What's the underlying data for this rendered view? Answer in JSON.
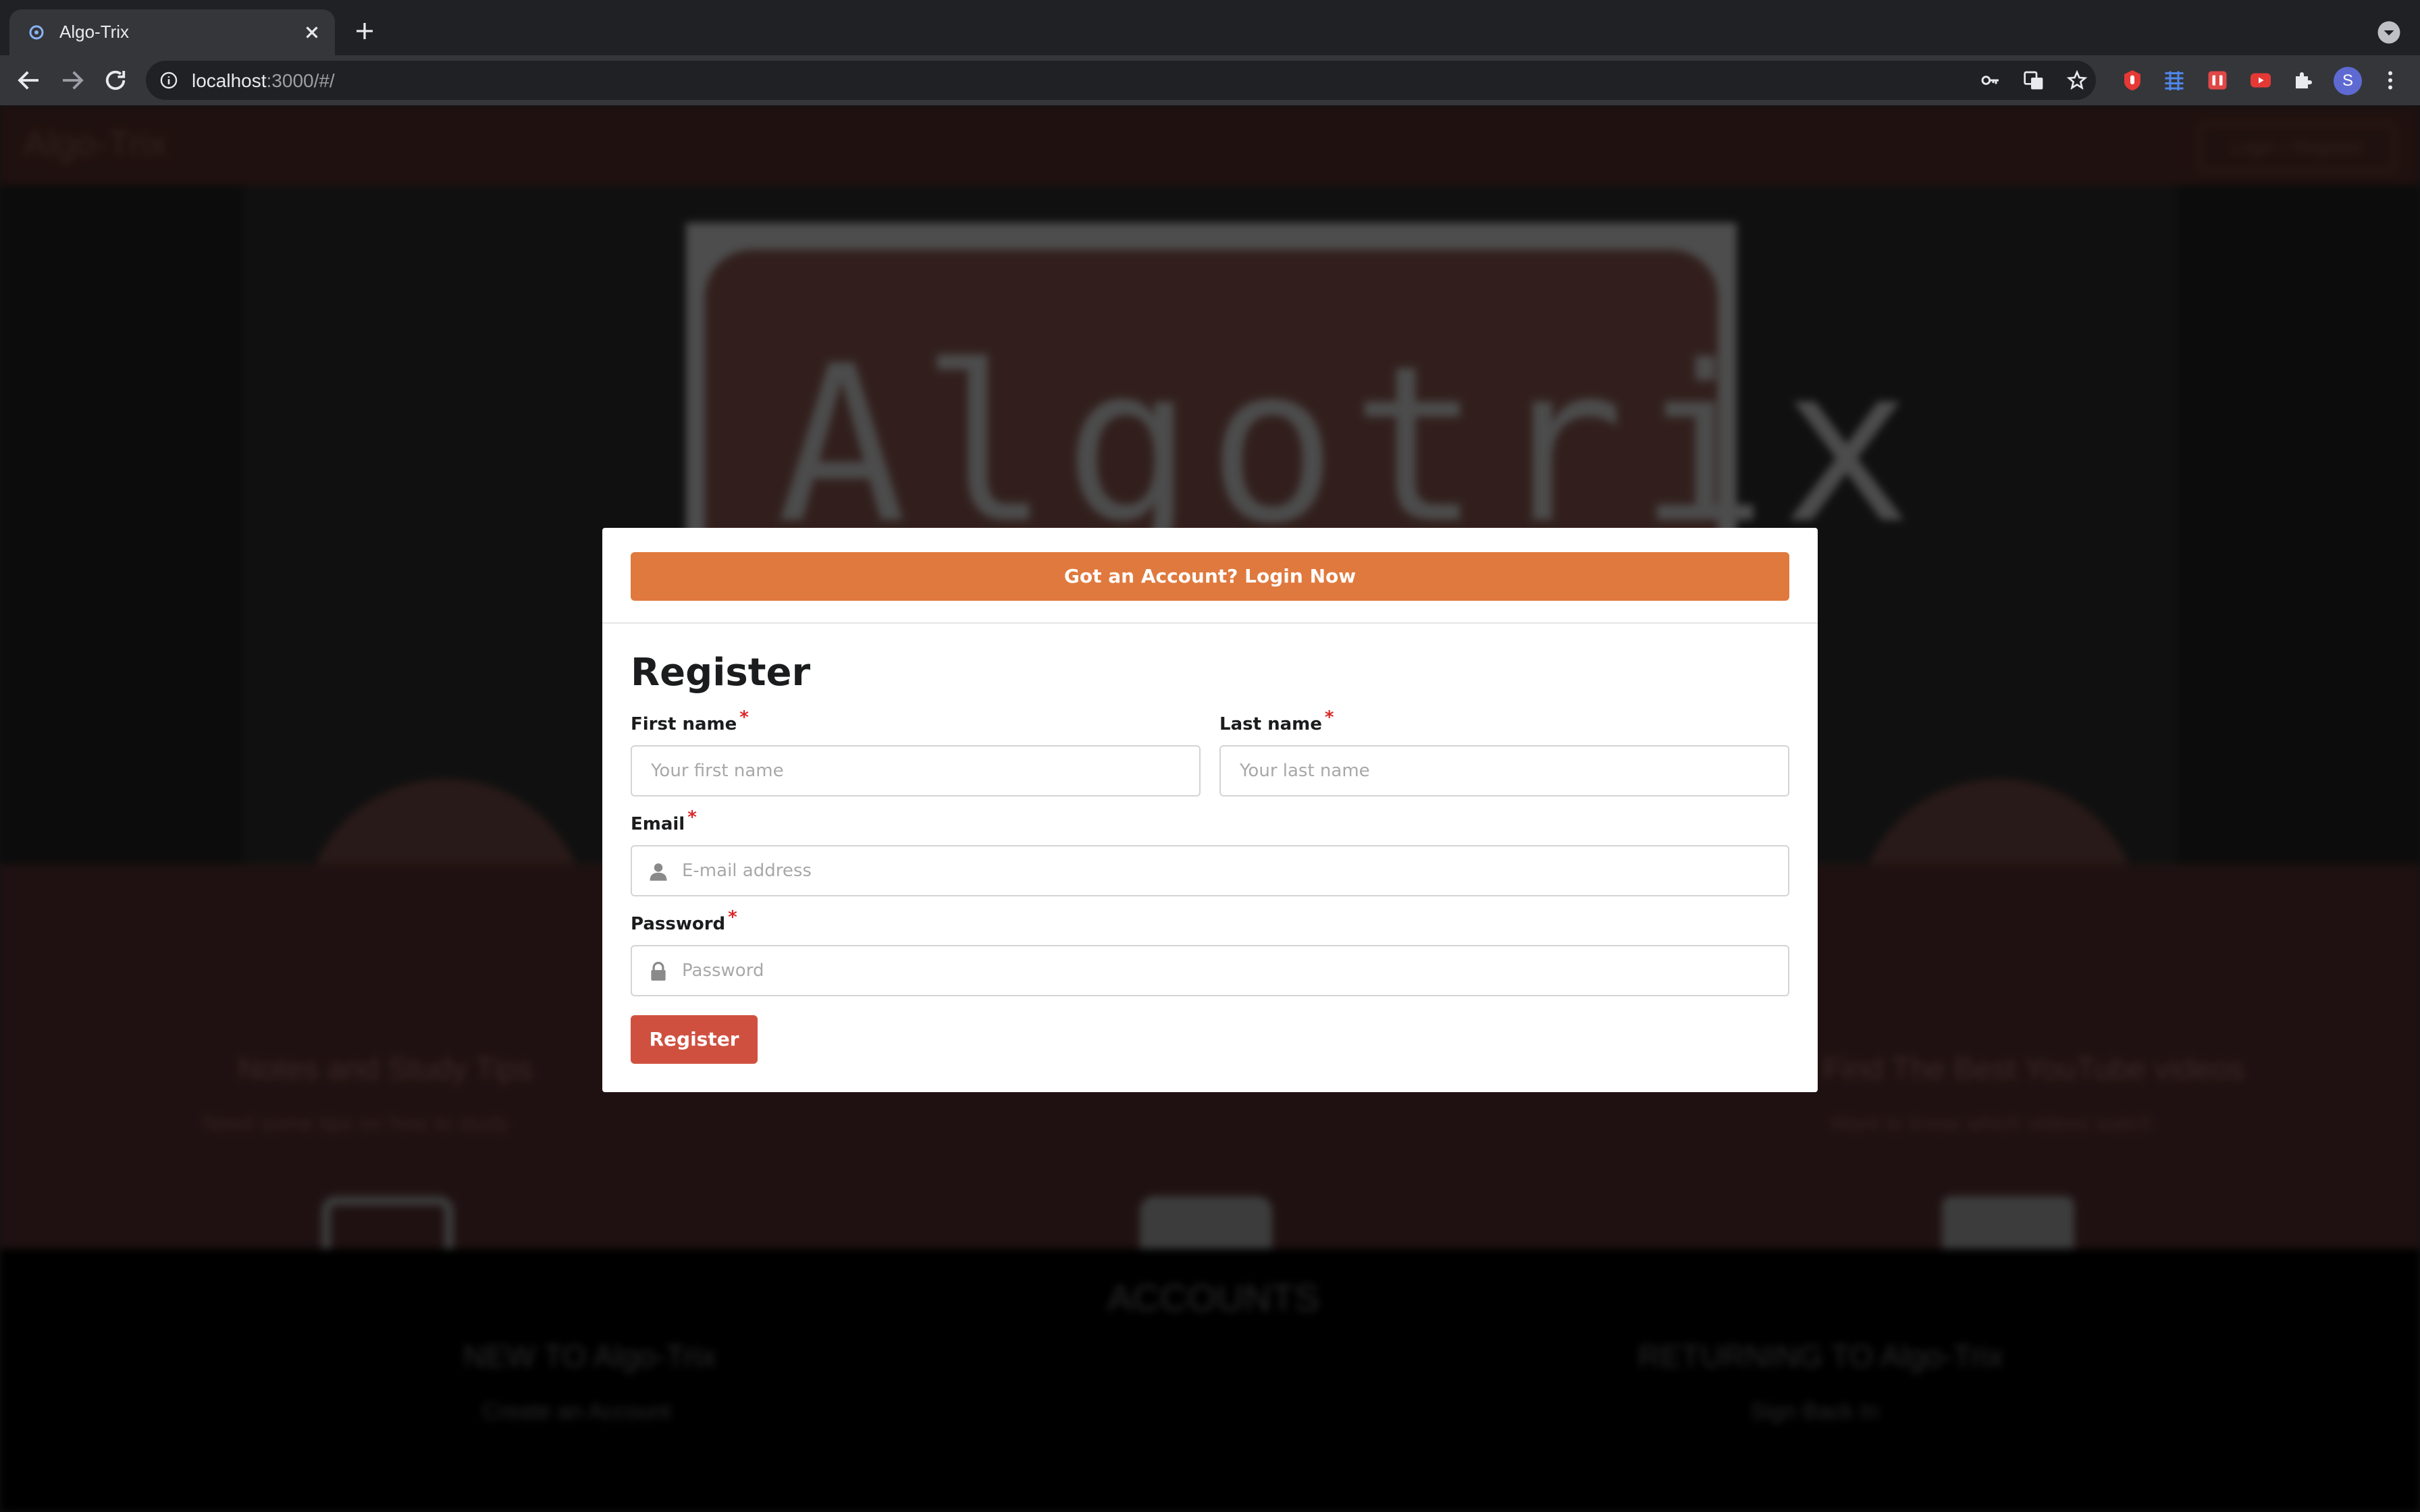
{
  "browser": {
    "tab_title": "Algo-Trix",
    "url_host": "localhost",
    "url_rest": ":3000/#/",
    "profile_initial": "S"
  },
  "background": {
    "brand": "Algo-Trix",
    "login_label": "Login / Register",
    "logo_text": "Algotrix",
    "features": [
      {
        "title": "Notes and Study Tips",
        "subtitle": "Need some tips on how to study"
      },
      {
        "title": "",
        "subtitle": ""
      },
      {
        "title": "Find The Best YouTube videos",
        "subtitle": "Want to know which videos watch"
      }
    ],
    "accounts_title": "ACCOUNTS",
    "new_title": "NEW TO Algo-Trix",
    "new_sub": "Create an Account",
    "returning_title": "RETURNING TO Algo-Trix",
    "returning_sub": "Sign Back In"
  },
  "modal": {
    "login_prompt": "Got an Account? Login Now",
    "title": "Register",
    "first_name": {
      "label": "First name",
      "placeholder": "Your first name",
      "value": ""
    },
    "last_name": {
      "label": "Last name",
      "placeholder": "Your last name",
      "value": ""
    },
    "email": {
      "label": "Email",
      "placeholder": "E-mail address",
      "value": ""
    },
    "password": {
      "label": "Password",
      "placeholder": "Password",
      "value": ""
    },
    "required_mark": "*",
    "submit_label": "Register"
  },
  "colors": {
    "accent_orange": "#e0793d",
    "submit_red": "#d05040",
    "required_red": "#db2828"
  }
}
